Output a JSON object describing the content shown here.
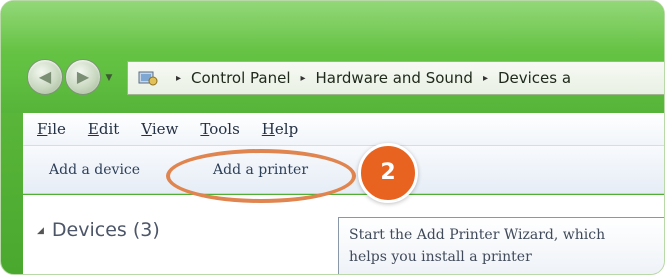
{
  "address_bar": {
    "crumbs": [
      "Control Panel",
      "Hardware and Sound",
      "Devices a"
    ],
    "separator": "▸"
  },
  "menu": {
    "items": [
      {
        "first": "F",
        "rest": "ile"
      },
      {
        "first": "E",
        "rest": "dit"
      },
      {
        "first": "V",
        "rest": "iew"
      },
      {
        "first": "T",
        "rest": "ools"
      },
      {
        "first": "H",
        "rest": "elp"
      }
    ]
  },
  "command_bar": {
    "add_device": "Add a device",
    "add_printer": "Add a printer"
  },
  "callout": {
    "step": "2",
    "color": "#e8631f"
  },
  "content": {
    "devices_header": "Devices (3)"
  },
  "tooltip": {
    "line1": "Start the Add Printer Wizard, which",
    "line2": "helps you install a printer"
  },
  "icons": {
    "back": "arrow-left-icon",
    "forward": "arrow-right-icon",
    "control_panel": "control-panel-icon"
  }
}
